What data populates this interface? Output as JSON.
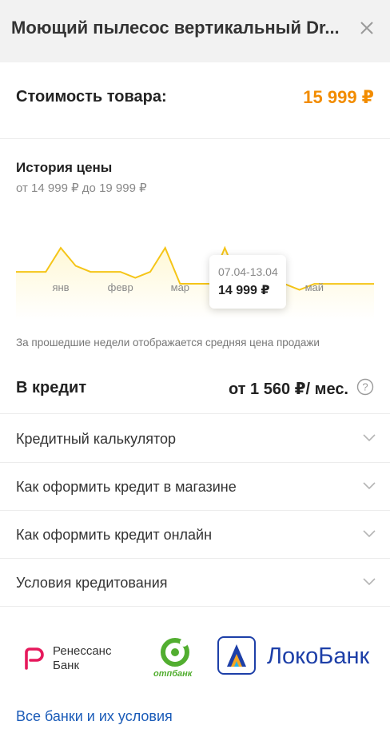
{
  "header": {
    "title": "Моющий пылесос вертикальный Dr...",
    "close_icon": "close-icon"
  },
  "price": {
    "label": "Стоимость товара:",
    "value": "15 999 ₽",
    "accent_color": "#f28c00"
  },
  "history": {
    "title": "История цены",
    "range": "от 14 999 ₽ до 19 999 ₽",
    "note": "За прошедшие недели отображается средняя цена продажи",
    "tooltip": {
      "dates": "07.04-13.04",
      "price": "14 999 ₽"
    }
  },
  "chart_data": {
    "type": "line",
    "line_color": "#f5c518",
    "fill_color": "#fff8d6",
    "month_labels": [
      "янв",
      "февр",
      "мар",
      "май"
    ],
    "month_positions_week_index": [
      3,
      7,
      11,
      20
    ],
    "series": [
      {
        "values": [
          15990,
          15990,
          15990,
          17990,
          16490,
          15990,
          15990,
          15990,
          15490,
          15990,
          17990,
          14999,
          14999,
          14999,
          17990,
          14999,
          14999,
          14999,
          14990,
          14490,
          14990,
          14990,
          14990,
          14990,
          14990
        ],
        "highlight_index": 15
      }
    ],
    "ylim": [
      12000,
      19999
    ]
  },
  "credit": {
    "label": "В кредит",
    "value": "от 1 560 ₽/ мес.",
    "help_icon": "question-circle-icon"
  },
  "accordion": [
    {
      "label": "Кредитный калькулятор"
    },
    {
      "label": "Как оформить кредит в магазине"
    },
    {
      "label": "Как оформить кредит онлайн"
    },
    {
      "label": "Условия кредитования"
    }
  ],
  "banks": {
    "renaissance": "Ренессанс\nБанк",
    "otp": "отпбанк",
    "loko": "ЛокоБанк"
  },
  "all_banks_link": "Все банки и их условия"
}
